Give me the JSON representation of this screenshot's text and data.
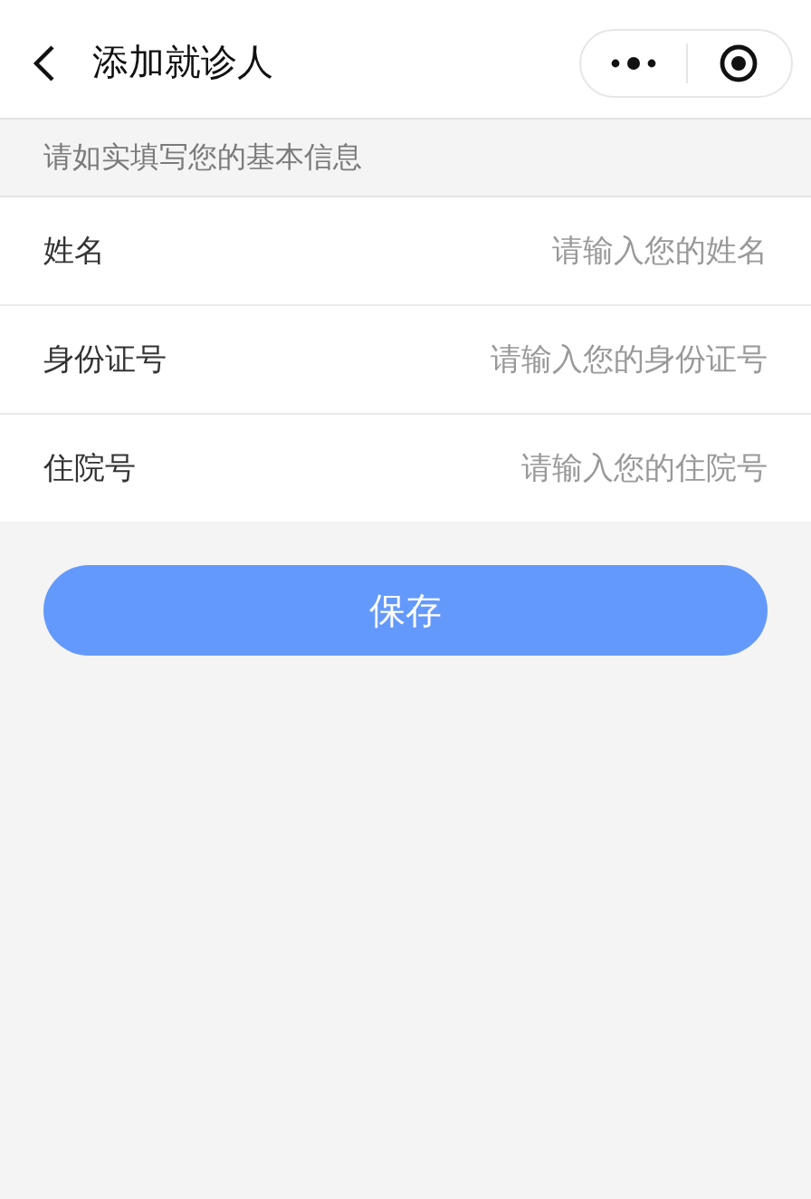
{
  "nav": {
    "title": "添加就诊人"
  },
  "hint": "请如实填写您的基本信息",
  "fields": [
    {
      "label": "姓名",
      "placeholder": "请输入您的姓名"
    },
    {
      "label": "身份证号",
      "placeholder": "请输入您的身份证号"
    },
    {
      "label": "住院号",
      "placeholder": "请输入您的住院号"
    }
  ],
  "save_button": "保存"
}
